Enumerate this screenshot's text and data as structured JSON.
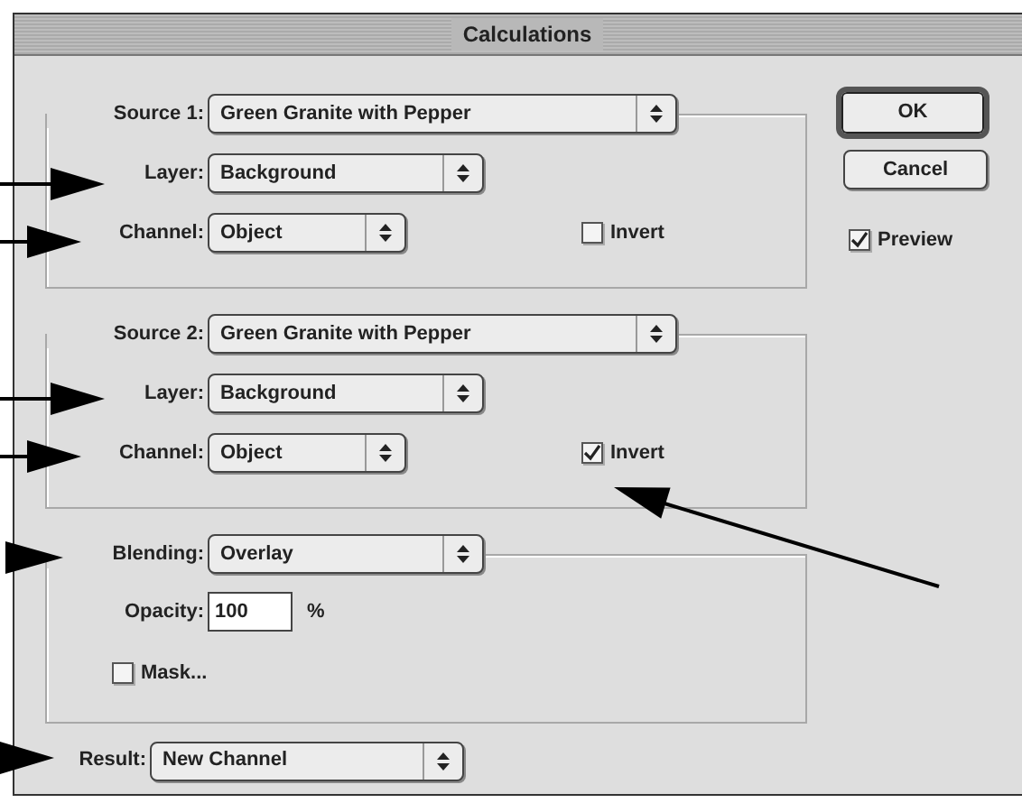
{
  "window": {
    "title": "Calculations"
  },
  "sources": [
    {
      "label": "Source 1:",
      "document": "Green Granite with Pepper",
      "layer_label": "Layer:",
      "layer": "Background",
      "channel_label": "Channel:",
      "channel": "Object",
      "invert": {
        "label": "Invert",
        "checked": false
      }
    },
    {
      "label": "Source 2:",
      "document": "Green Granite with Pepper",
      "layer_label": "Layer:",
      "layer": "Background",
      "channel_label": "Channel:",
      "channel": "Object",
      "invert": {
        "label": "Invert",
        "checked": true
      }
    }
  ],
  "blending": {
    "label": "Blending:",
    "mode": "Overlay",
    "opacity_label": "Opacity:",
    "opacity": "100",
    "opacity_unit": "%",
    "mask": {
      "label": "Mask...",
      "checked": false
    }
  },
  "result": {
    "label": "Result:",
    "value": "New Channel"
  },
  "buttons": [
    {
      "label": "OK",
      "default": true
    },
    {
      "label": "Cancel",
      "default": false
    }
  ],
  "preview": {
    "label": "Preview",
    "checked": true
  }
}
